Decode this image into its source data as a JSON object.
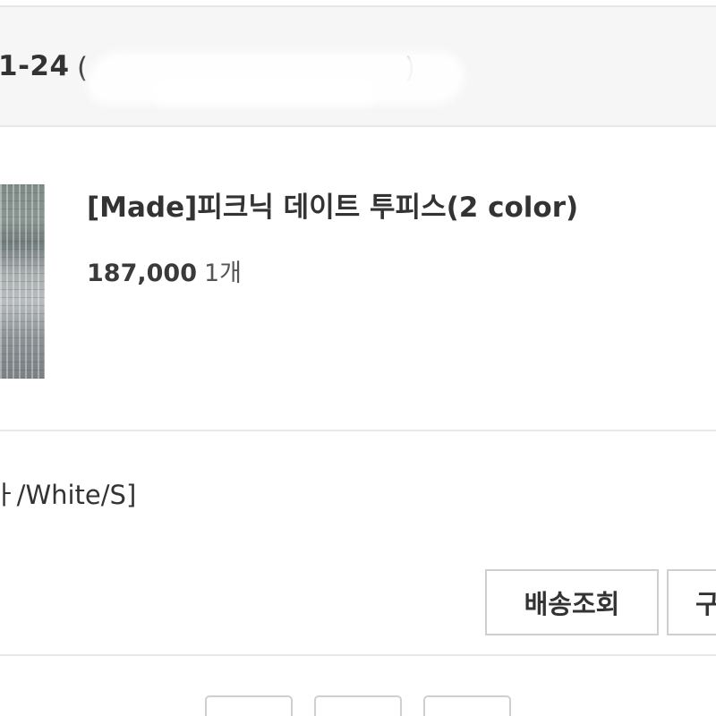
{
  "order": {
    "number_visible": "1-24",
    "paren_open": "(",
    "paren_close": ")"
  },
  "product": {
    "name": "[Made]피크닉 데이트 투피스(2 color)",
    "price": "187,000",
    "quantity": "1개",
    "option": "ㅏ/White/S]"
  },
  "actions": {
    "tracking_label": "배송조회",
    "second_label": "구"
  },
  "pagination": {
    "buttons": [
      "",
      "",
      ""
    ]
  }
}
